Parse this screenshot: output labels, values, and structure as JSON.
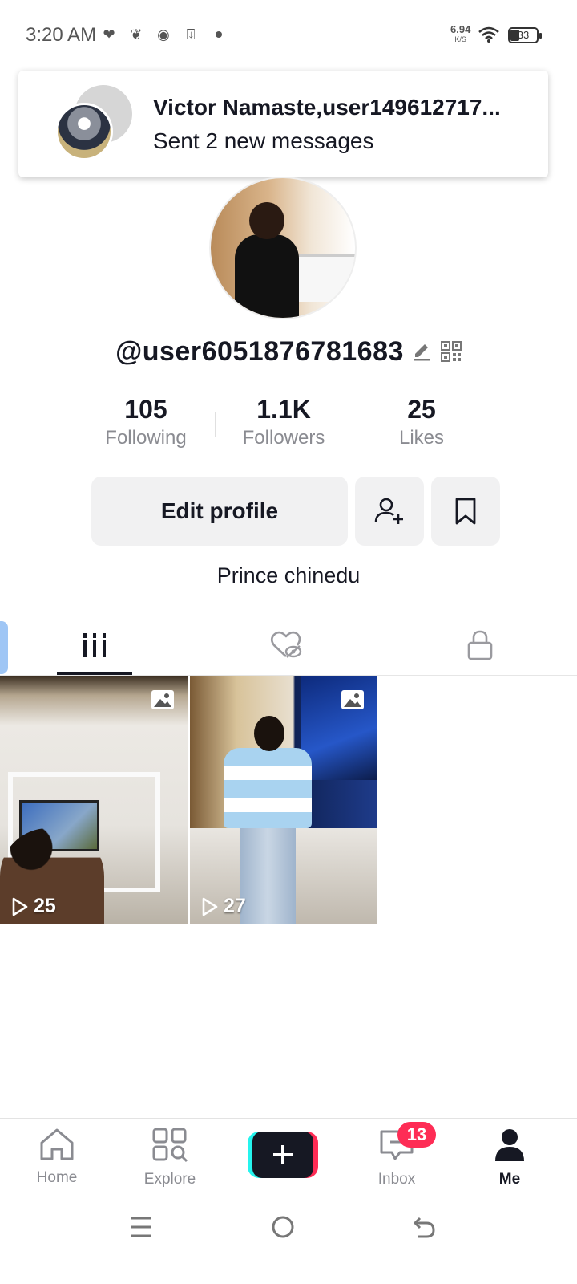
{
  "status_bar": {
    "time": "3:20 AM",
    "net_speed": "6.94",
    "net_unit": "K/S",
    "battery": "33"
  },
  "notification": {
    "title": "Victor Namaste,user149612717...",
    "body": "Sent 2 new messages"
  },
  "profile": {
    "username": "@user6051876781683",
    "stats": [
      {
        "value": "105",
        "label": "Following"
      },
      {
        "value": "1.1K",
        "label": "Followers"
      },
      {
        "value": "25",
        "label": "Likes"
      }
    ],
    "edit_label": "Edit profile",
    "bio": "Prince chinedu"
  },
  "tabs": [
    {
      "icon": "videos-grid-icon",
      "active": true
    },
    {
      "icon": "liked-hidden-icon",
      "active": false
    },
    {
      "icon": "private-lock-icon",
      "active": false
    }
  ],
  "videos": [
    {
      "plays": "25",
      "type": "photo"
    },
    {
      "plays": "27",
      "type": "photo"
    }
  ],
  "bottom_nav": {
    "home": "Home",
    "explore": "Explore",
    "inbox": "Inbox",
    "inbox_badge": "13",
    "me": "Me"
  },
  "colors": {
    "accent_red": "#fe2c55",
    "accent_cyan": "#25f4ee",
    "text_primary": "#161823",
    "text_secondary": "#8a8b91"
  }
}
